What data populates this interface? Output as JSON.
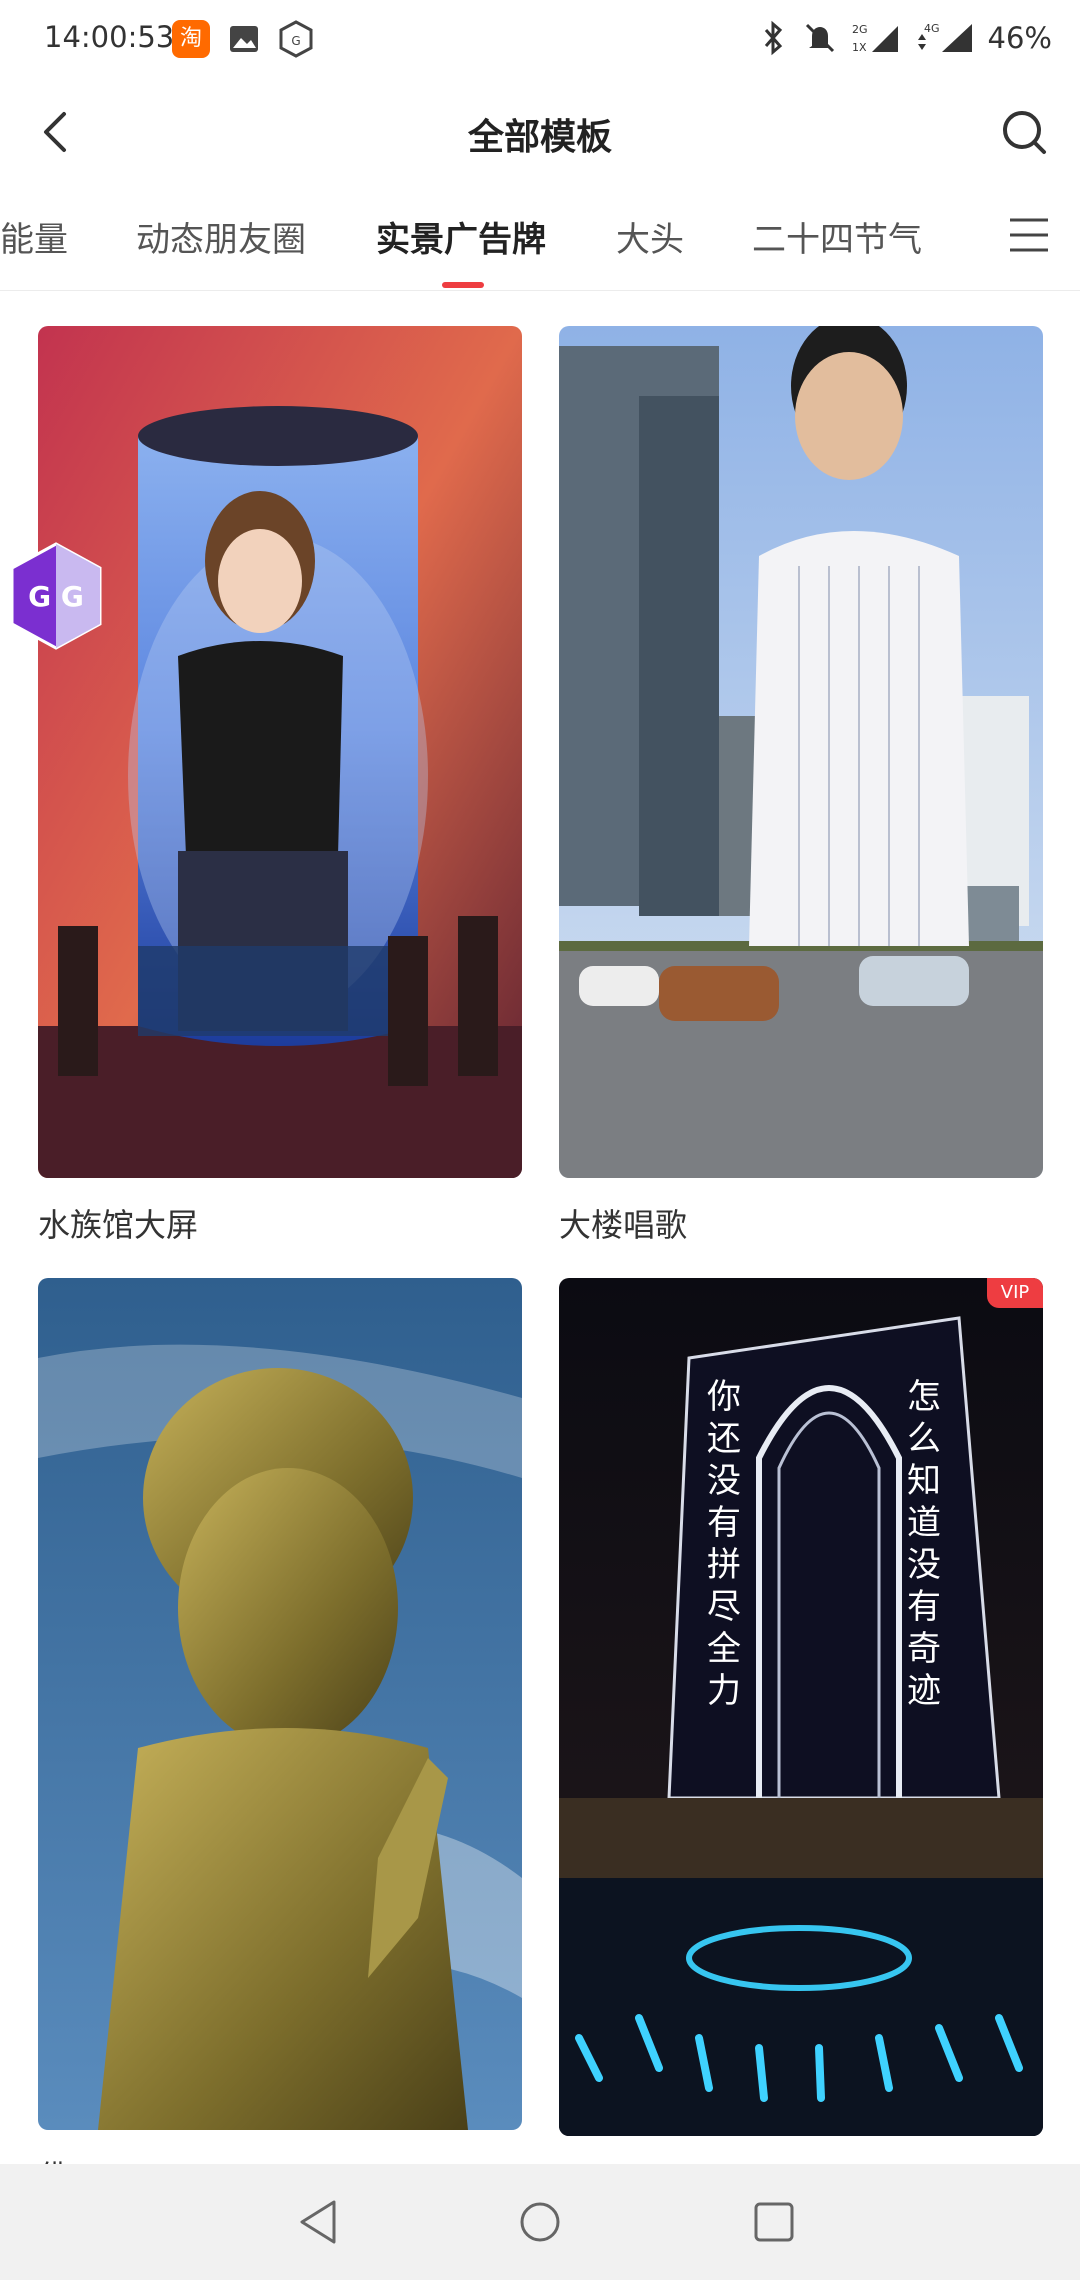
{
  "status_bar": {
    "time": "14:00:53",
    "taobao_badge": "淘",
    "battery": "46%",
    "icons": [
      "taobao-icon",
      "gallery-icon",
      "gg-icon",
      "bluetooth-icon",
      "mute-bell-icon",
      "signal-2g-icon",
      "signal-4g-icon"
    ]
  },
  "header": {
    "title": "全部模板",
    "back_icon": "chevron-left-icon",
    "search_icon": "search-icon"
  },
  "tabs": {
    "items": [
      {
        "label": "能量",
        "active": false
      },
      {
        "label": "动态朋友圈",
        "active": false
      },
      {
        "label": "实景广告牌",
        "active": true
      },
      {
        "label": "大头",
        "active": false
      },
      {
        "label": "二十四节气",
        "active": false
      }
    ],
    "menu_icon": "menu-icon",
    "accent_color": "#ee3d41"
  },
  "templates": [
    {
      "title": "水族馆大屏",
      "vip": false
    },
    {
      "title": "大楼唱歌",
      "vip": false
    },
    {
      "title": "佛",
      "vip": false
    },
    {
      "title": "",
      "vip": true,
      "vip_label": "VIP",
      "overlay_left": "你还没有拼尽全力",
      "overlay_right": "怎么知道没有奇迹"
    }
  ],
  "floating": {
    "gg_label": "G G"
  },
  "nav_bar": {
    "icons": [
      "back-triangle-icon",
      "home-circle-icon",
      "recents-square-icon"
    ]
  }
}
